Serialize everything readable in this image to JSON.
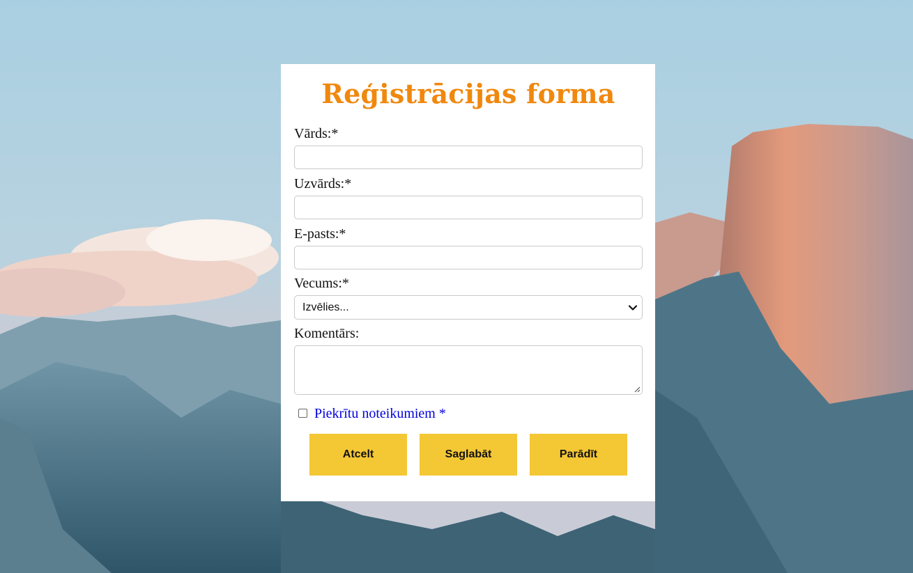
{
  "form": {
    "title": "Reģistrācijas forma",
    "fields": {
      "first_name": {
        "label": "Vārds:*",
        "value": ""
      },
      "last_name": {
        "label": "Uzvārds:*",
        "value": ""
      },
      "email": {
        "label": "E-pasts:*",
        "value": ""
      },
      "age": {
        "label": "Vecums:*",
        "selected": "Izvēlies..."
      },
      "comment": {
        "label": "Komentārs:",
        "value": ""
      }
    },
    "agree": {
      "label": "Piekrītu noteikumiem *",
      "checked": false
    },
    "buttons": {
      "cancel": "Atcelt",
      "save": "Saglabāt",
      "show": "Parādīt"
    }
  },
  "colors": {
    "title": "#f0880e",
    "button": "#f4c735",
    "agree_link": "#0000dd",
    "card": "#ffffff"
  },
  "icons": {
    "select": "chevron-down-icon",
    "textarea": "resize-grip-icon",
    "agree": "checkbox"
  }
}
